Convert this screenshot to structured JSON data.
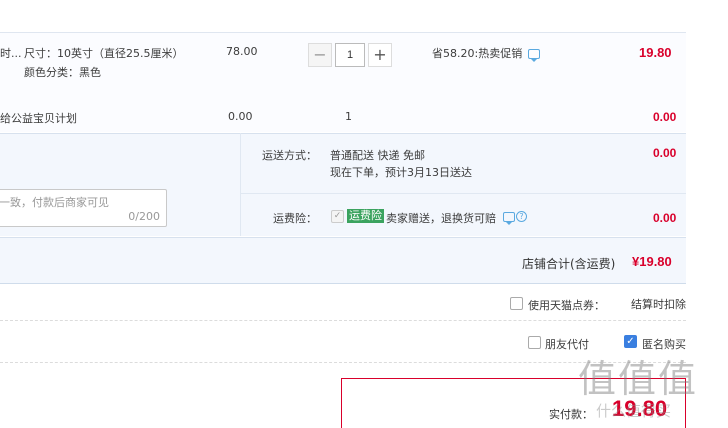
{
  "item": {
    "title_fragment": "时...",
    "size": "尺寸：10英寸（直径25.5厘米）",
    "color": "颜色分类：黑色",
    "unit_price": "78.00",
    "quantity": "1",
    "minus": "−",
    "plus": "+",
    "promo": "省58.20:热卖促销",
    "subtotal": "19.80"
  },
  "charity": {
    "label": "给公益宝贝计划",
    "price": "0.00",
    "quantity": "1",
    "subtotal": "0.00"
  },
  "shipping": {
    "label": "运送方式：",
    "method": "普通配送 快递 免邮",
    "eta": "现在下单，预计3月13日送达",
    "price": "0.00"
  },
  "insurance": {
    "label": "运费险：",
    "tag": "运费险",
    "desc": "卖家赠送，退换货可赔",
    "price": "0.00"
  },
  "memo": {
    "placeholder": "一致，付款后商家可见",
    "count": "0/200"
  },
  "shop_total": {
    "label": "店铺合计(含运费)",
    "value": "¥19.80"
  },
  "points": {
    "label": "使用天猫点券：",
    "note": "结算时扣除"
  },
  "options": {
    "friend_pay": "朋友代付",
    "anonymous": "匿名购买"
  },
  "pay": {
    "label": "实付款：",
    "value": "19.80"
  },
  "watermark": {
    "text": "值值值",
    "url": "什么值得买"
  },
  "colors": {
    "accent_red": "#d9002b",
    "link_blue": "#3a7fe0",
    "tag_green": "#3ba35f"
  }
}
